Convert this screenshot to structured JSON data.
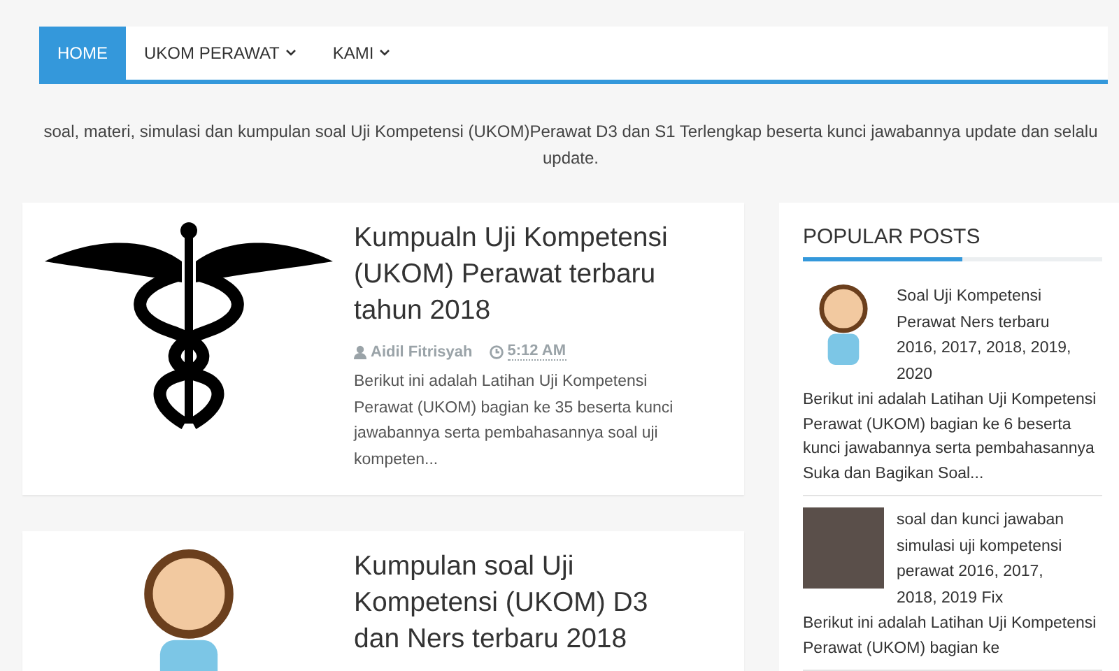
{
  "nav": {
    "items": [
      {
        "label": "HOME",
        "selected": true,
        "has_dropdown": false
      },
      {
        "label": "UKOM PERAWAT",
        "selected": false,
        "has_dropdown": true
      },
      {
        "label": "KAMI",
        "selected": false,
        "has_dropdown": true
      }
    ]
  },
  "tagline": "soal, materi, simulasi dan kumpulan soal Uji Kompetensi (UKOM)Perawat D3 dan S1 Terlengkap beserta kunci jawabannya update dan selalu update.",
  "posts": [
    {
      "kind": "caduceus",
      "title": "Kumpualn Uji Kompetensi (UKOM) Perawat terbaru tahun 2018",
      "author": "Aidil Fitrisyah",
      "time": "5:12 AM",
      "excerpt": "Berikut ini adalah Latihan Uji Kompetensi Perawat (UKOM) bagian ke 35 beserta kunci jawabannya serta pembahasannya soal uji kompeten..."
    },
    {
      "kind": "cartoon",
      "title": "Kumpulan soal Uji Kompetensi (UKOM) D3 dan Ners terbaru 2018"
    }
  ],
  "sidebar": {
    "title": "POPULAR POSTS",
    "posts": [
      {
        "kind": "cartoon",
        "title": "Soal Uji Kompetensi Perawat Ners terbaru 2016, 2017, 2018, 2019, 2020",
        "excerpt": "Berikut ini adalah Latihan Uji Kompetensi Perawat (UKOM) bagian ke 6 beserta kunci jawabannya serta pembahasannya Suka dan Bagikan Soal..."
      },
      {
        "kind": "photo",
        "title": "soal dan kunci jawaban simulasi uji kompetensi perawat 2016, 2017, 2018, 2019 Fix",
        "excerpt": "Berikut ini adalah Latihan Uji Kompetensi Perawat (UKOM) bagian ke"
      }
    ]
  }
}
